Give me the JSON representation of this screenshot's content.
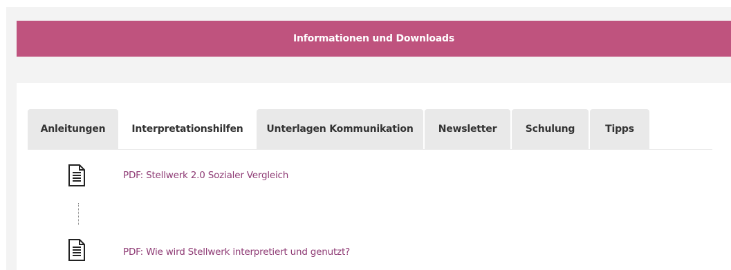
{
  "banner": {
    "title": "Informationen und Downloads"
  },
  "tabs": [
    {
      "label": "Anleitungen",
      "active": false
    },
    {
      "label": "Interpretationshilfen",
      "active": true
    },
    {
      "label": "Unterlagen Kommunikation",
      "active": false
    },
    {
      "label": "Newsletter",
      "active": false
    },
    {
      "label": "Schulung",
      "active": false
    },
    {
      "label": "Tipps",
      "active": false
    }
  ],
  "documents": [
    {
      "label": "PDF: Stellwerk 2.0 Sozialer Vergleich",
      "icon": "document-icon"
    },
    {
      "label": "PDF: Wie wird Stellwerk interpretiert und genutzt?",
      "icon": "document-icon"
    }
  ],
  "colors": {
    "accent": "#bf537e",
    "link": "#8e3a74",
    "tab_bg": "#e9e9e9"
  }
}
